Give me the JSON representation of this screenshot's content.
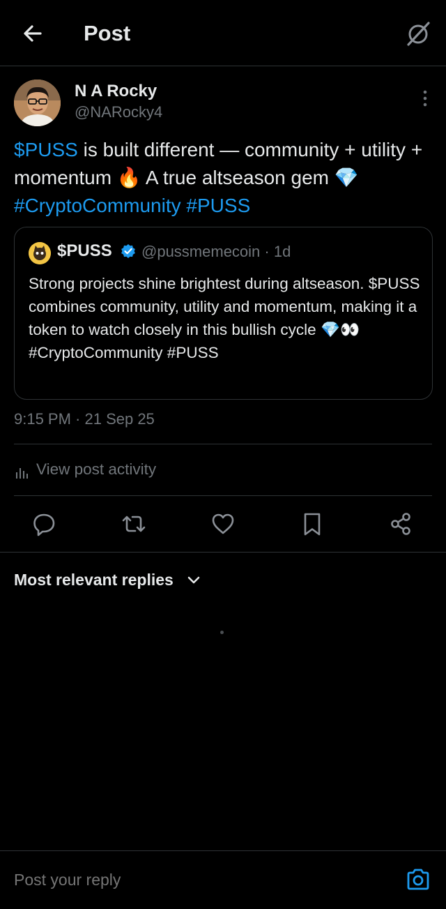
{
  "header": {
    "title": "Post"
  },
  "author": {
    "name": "N A Rocky",
    "handle": "@NARocky4"
  },
  "post": {
    "segments": [
      {
        "text": "$PUSS",
        "link": true
      },
      {
        "text": " is built different — community + utility + momentum 🔥 A true altseason gem 💎 ",
        "link": false
      },
      {
        "text": "#CryptoCommunity",
        "link": true
      },
      {
        "text": " ",
        "link": false
      },
      {
        "text": "#PUSS",
        "link": true
      }
    ]
  },
  "quote": {
    "name": "$PUSS",
    "handle_time": "@pussmemecoin · 1d",
    "text": "Strong projects shine brightest during altseason. $PUSS combines community, utility and momentum, making it a token to watch closely in this bullish cycle 💎👀\n#CryptoCommunity  #PUSS"
  },
  "timestamp": "9:15 PM · 21 Sep 25",
  "activity": {
    "label": "View post activity"
  },
  "replies": {
    "sort_label": "Most relevant replies"
  },
  "reply_bar": {
    "placeholder": "Post your reply"
  },
  "colors": {
    "accent": "#1d9bf0",
    "muted": "#71767b",
    "divider": "#2f3336",
    "verified": "#1d9bf0"
  }
}
